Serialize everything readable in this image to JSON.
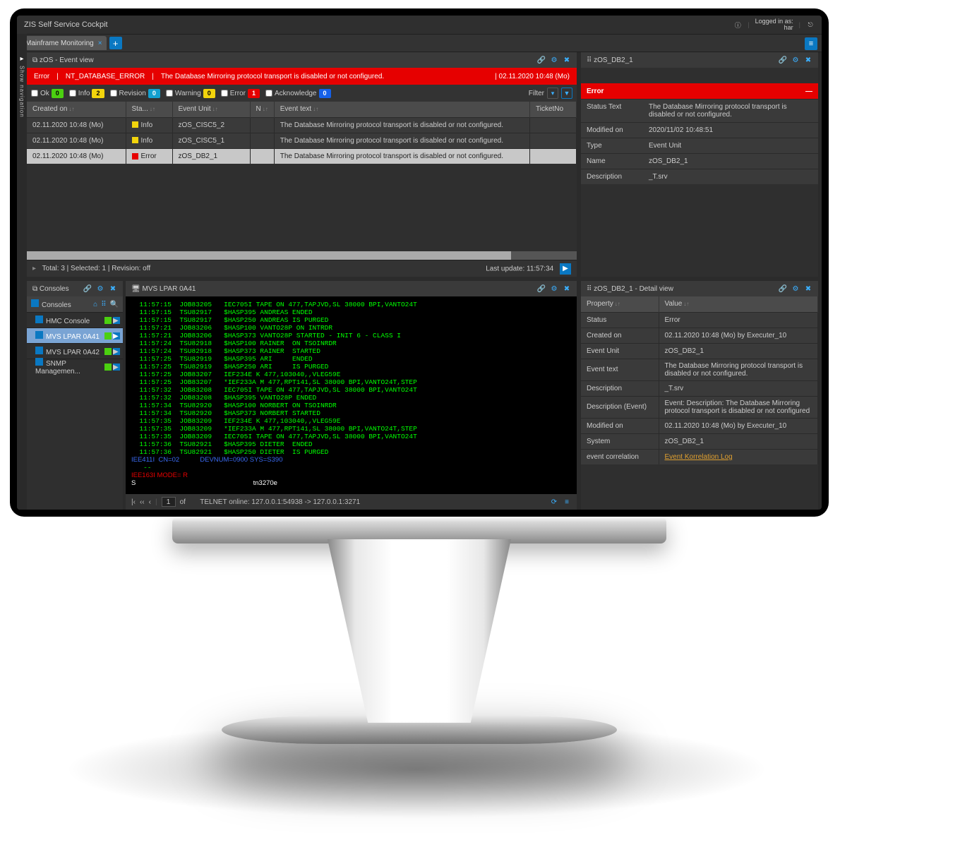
{
  "app_title": "ZIS Self Service Cockpit",
  "logged_in_label": "Logged in as:",
  "logged_in_user": "har",
  "nav_toggle": "Show navigation",
  "tab": {
    "label": "Mainframe Monitoring"
  },
  "panels": {
    "event_view": {
      "title": "zOS - Event view",
      "error_banner": {
        "level": "Error",
        "code": "NT_DATABASE_ERROR",
        "text": "The Database Mirroring protocol transport is disabled or not configured.",
        "date": "02.11.2020 10:48 (Mo)"
      },
      "filters": {
        "ok": {
          "label": "Ok",
          "count": "0"
        },
        "info": {
          "label": "Info",
          "count": "2"
        },
        "revision": {
          "label": "Revision",
          "count": "0"
        },
        "warning": {
          "label": "Warning",
          "count": "0"
        },
        "error": {
          "label": "Error",
          "count": "1"
        },
        "acknowledge": {
          "label": "Acknowledge",
          "count": "0"
        },
        "filter_label": "Filter"
      },
      "columns": [
        "Created on",
        "Sta...",
        "Event Unit",
        "N",
        "Event text",
        "TicketNo"
      ],
      "rows": [
        {
          "created": "02.11.2020 10:48 (Mo)",
          "status": "Info",
          "status_color": "yellow",
          "unit": "zOS_CISC5_2",
          "text": "The Database Mirroring protocol transport is disabled or not configured.",
          "sel": false
        },
        {
          "created": "02.11.2020 10:48 (Mo)",
          "status": "Info",
          "status_color": "yellow",
          "unit": "zOS_CISC5_1",
          "text": "The Database Mirroring protocol transport is disabled or not configured.",
          "sel": false
        },
        {
          "created": "02.11.2020 10:48 (Mo)",
          "status": "Error",
          "status_color": "red",
          "unit": "zOS_DB2_1",
          "text": "The Database Mirroring protocol transport is disabled or not configured.",
          "sel": true
        }
      ],
      "status": {
        "total": "Total: 3",
        "selected": "Selected: 1",
        "rev": "Revision: off",
        "last": "Last update: 11:57:34"
      }
    },
    "right_top": {
      "title": "zOS_DB2_1",
      "box_title": "Error",
      "rows": [
        {
          "k": "Status Text",
          "v": "The Database Mirroring protocol transport is disabled or not configured."
        },
        {
          "k": "Modified on",
          "v": "2020/11/02 10:48:51"
        },
        {
          "k": "Type",
          "v": "Event Unit"
        },
        {
          "k": "Name",
          "v": "zOS_DB2_1"
        },
        {
          "k": "Description",
          "v": "_T.srv"
        }
      ]
    },
    "consoles": {
      "title": "Consoles",
      "header2": "Consoles",
      "items": [
        {
          "label": "HMC Console",
          "active": false
        },
        {
          "label": "MVS LPAR 0A41",
          "active": true
        },
        {
          "label": "MVS LPAR 0A42",
          "active": false
        },
        {
          "label": "SNMP Managemen...",
          "active": false
        }
      ]
    },
    "terminal": {
      "title": "MVS LPAR 0A41",
      "lines": [
        "  11:57:15  JOB83205   IEC705I TAPE ON 477,TAPJVD,SL 38000 BPI,VANTO24T",
        "  11:57:15  TSU82917   $HASP395 ANDREAS ENDED",
        "  11:57:15  TSU82917   $HASP250 ANDREAS IS PURGED",
        "  11:57:21  JOB83206   $HASP100 VANTO28P ON INTRDR",
        "  11:57:21  JOB83206   $HASP373 VANTO28P STARTED - INIT 6 - CLASS I",
        "  11:57:24  TSU82918   $HASP100 RAINER  ON TSOINRDR",
        "  11:57:24  TSU82918   $HASP373 RAINER  STARTED",
        "  11:57:25  TSU82919   $HASP395 ARI     ENDED",
        "  11:57:25  TSU82919   $HASP250 ARI     IS PURGED",
        "  11:57:25  JOB83207   IEF234E K 477,103040,,VLEG59E",
        "  11:57:25  JOB83207   *IEF233A M 477,RPT141,SL 38000 BPI,VANTO24T,STEP",
        "  11:57:32  JOB83208   IEC705I TAPE ON 477,TAPJVD,SL 38000 BPI,VANTO24T",
        "  11:57:32  JOB83208   $HASP395 VANTO28P ENDED",
        "  11:57:34  TSU82920   $HASP100 NORBERT ON TSOINRDR",
        "  11:57:34  TSU82920   $HASP373 NORBERT STARTED",
        "  11:57:35  JOB83209   IEF234E K 477,103040,,VLEG59E",
        "  11:57:35  JOB83209   *IEF233A M 477,RPT141,SL 38000 BPI,VANTO24T,STEP",
        "  11:57:35  JOB83209   IEC705I TAPE ON 477,TAPJVD,SL 38000 BPI,VANTO24T",
        "  11:57:36  TSU82921   $HASP395 DIETER  ENDED",
        "  11:57:36  TSU82921   $HASP250 DIETER  IS PURGED"
      ],
      "line_blue": "IEE411I  CN=02           DEVNUM=0900 SYS=S390",
      "line_dashes": "   --",
      "line_mode": "IEE163I MODE= R",
      "line_prompt": "S                                                               tn3270e",
      "page": "1",
      "of": "of",
      "telnet": "TELNET online: 127.0.0.1:54938 -> 127.0.0.1:3271"
    },
    "detail_view": {
      "title": "zOS_DB2_1 - Detail view",
      "head": [
        "Property",
        "Value"
      ],
      "rows": [
        {
          "k": "Status",
          "v": "Error"
        },
        {
          "k": "Created on",
          "v": "02.11.2020 10:48 (Mo) by Executer_10"
        },
        {
          "k": "Event Unit",
          "v": "zOS_DB2_1"
        },
        {
          "k": "Event text",
          "v": "The Database Mirroring protocol transport is disabled or not configured."
        },
        {
          "k": "Description",
          "v": "_T.srv"
        },
        {
          "k": "Description (Event)",
          "v": "Event: Description: The Database Mirroring protocol transport is disabled or not configured"
        },
        {
          "k": "Modified on",
          "v": "02.11.2020 10:48 (Mo) by Executer_10"
        },
        {
          "k": "System",
          "v": "zOS_DB2_1"
        },
        {
          "k": "event correlation",
          "v": "Event Korrelation Log",
          "link": true
        }
      ]
    }
  }
}
